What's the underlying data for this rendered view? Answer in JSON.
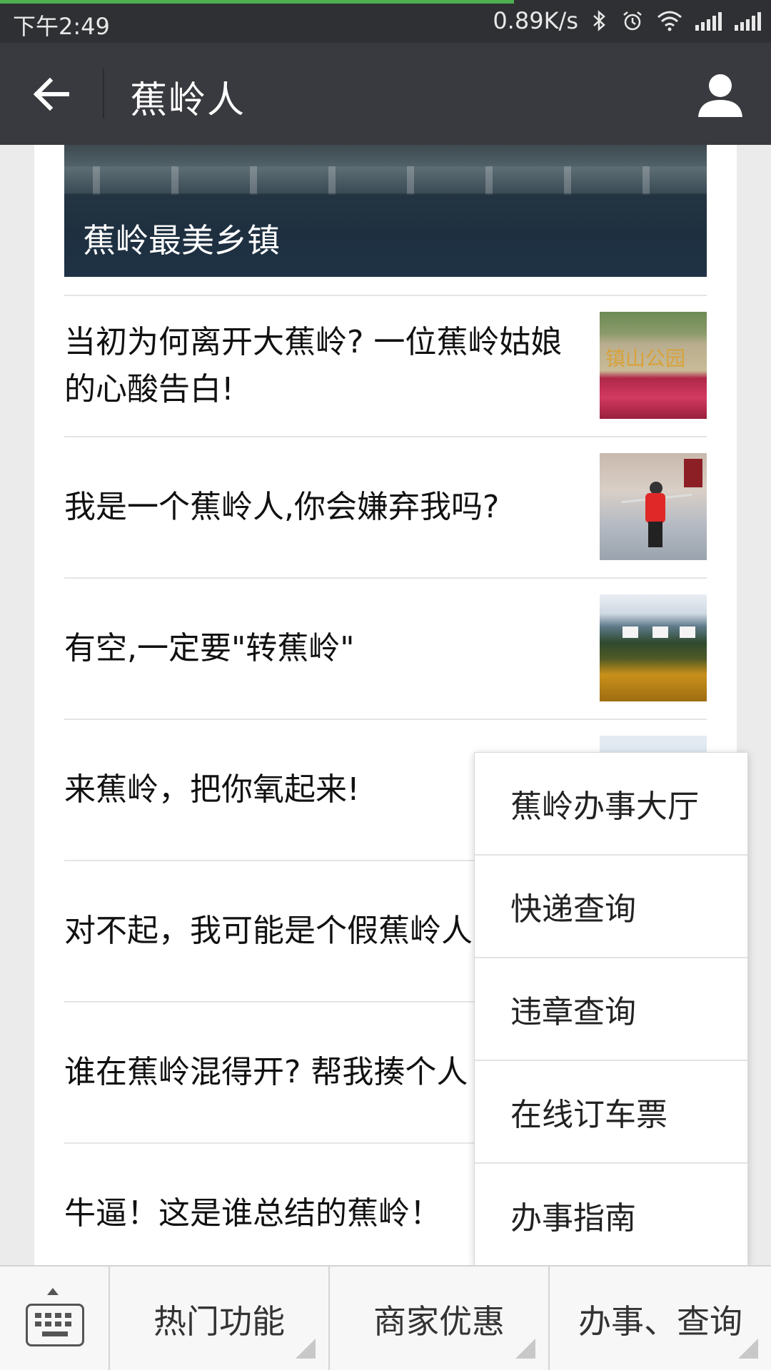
{
  "status_bar": {
    "time": "下午2:49",
    "speed": "0.89K/s",
    "icons": [
      "bluetooth-icon",
      "alarm-icon",
      "wifi-icon",
      "signal-icon",
      "signal-icon"
    ]
  },
  "app_bar": {
    "title": "蕉岭人",
    "background": "#393a3f"
  },
  "hero": {
    "caption": "蕉岭最美乡镇"
  },
  "articles": [
    {
      "title": "当初为何离开大蕉岭? 一位蕉岭姑娘的心酸告白!",
      "thumb_text": "镇山公园"
    },
    {
      "title": "我是一个蕉岭人,你会嫌弃我吗?"
    },
    {
      "title": "有空,一定要\"转蕉岭\""
    },
    {
      "title": "来蕉岭，把你氧起来!"
    },
    {
      "title": "对不起，我可能是个假蕉岭人"
    },
    {
      "title": "谁在蕉岭混得开? 帮我揍个人"
    },
    {
      "title": "牛逼！这是谁总结的蕉岭！"
    }
  ],
  "dropdown_menu": {
    "items": [
      "蕉岭办事大厅",
      "快递查询",
      "违章查询",
      "在线订车票",
      "办事指南"
    ]
  },
  "bottom_menu": {
    "items": [
      "热门功能",
      "商家优惠",
      "办事、查询"
    ]
  },
  "colors": {
    "status_bar": "#2f3033",
    "accent_progress": "#4caf50",
    "page_background": "#ebebeb"
  }
}
